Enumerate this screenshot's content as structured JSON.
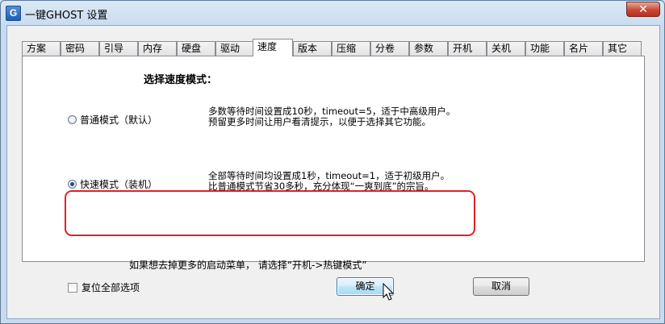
{
  "window": {
    "title": "一键GHOST 设置",
    "icon_letter": "G",
    "close_symbol": "✕"
  },
  "tabs": [
    "方案",
    "密码",
    "引导",
    "内存",
    "硬盘",
    "驱动",
    "速度",
    "版本",
    "压缩",
    "分卷",
    "参数",
    "开机",
    "关机",
    "功能",
    "名片",
    "其它"
  ],
  "active_tab": "速度",
  "panel": {
    "heading": "选择速度模式：",
    "option_normal": {
      "label": "普通模式（默认）",
      "desc_line1": "多数等待时间设置成10秒，timeout=5，适于中高级用户。",
      "desc_line2": "预留更多时间让用户看清提示，以便于选择其它功能。",
      "checked": false
    },
    "option_fast": {
      "label": "快速模式（装机）",
      "desc_line1": "全部等待时间均设置成1秒，timeout=1，适于初级用户。",
      "desc_line2": "比普通模式节省30多秒，充分体现“一爽到底”的宗旨。",
      "checked": true
    },
    "hint": "如果想去掉更多的启动菜单， 请选择“开机->热键模式”"
  },
  "footer": {
    "reset_all_label": "复位全部选项",
    "reset_all_checked": false,
    "ok_label": "确定",
    "cancel_label": "取消"
  },
  "colors": {
    "highlight_border": "#e0202a",
    "default_button_border": "#3c7fb1"
  }
}
